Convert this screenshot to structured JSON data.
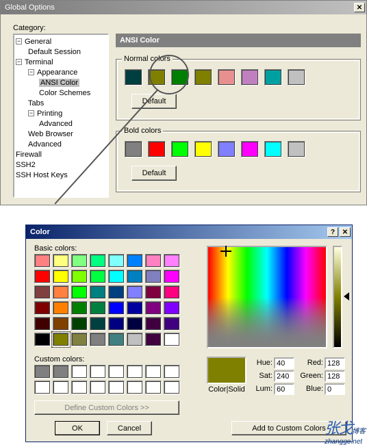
{
  "global": {
    "title": "Global Options",
    "category_label": "Category:",
    "tree": {
      "general": "General",
      "default_session": "Default Session",
      "terminal": "Terminal",
      "appearance": "Appearance",
      "ansi_color": "ANSI Color",
      "color_schemes": "Color Schemes",
      "tabs": "Tabs",
      "printing": "Printing",
      "advanced": "Advanced",
      "web_browser": "Web Browser",
      "advanced2": "Advanced",
      "firewall": "Firewall",
      "ssh2": "SSH2",
      "ssh_host_keys": "SSH Host Keys"
    },
    "panel_title": "ANSI Color",
    "normal_label": "Normal colors",
    "bold_label": "Bold colors",
    "default_btn": "Default",
    "normal_colors": [
      "#003f3f",
      "#808000",
      "#008000",
      "#7f7f00",
      "#e89090",
      "#c080c0",
      "#00a0a0",
      "#c0c0c0"
    ],
    "bold_colors": [
      "#808080",
      "#ff0000",
      "#00ff00",
      "#ffff00",
      "#8080ff",
      "#ff00ff",
      "#00ffff",
      "#c0c0c0"
    ]
  },
  "colordlg": {
    "title": "Color",
    "basic_label": "Basic colors:",
    "custom_label": "Custom colors:",
    "define_btn": "Define Custom Colors >>",
    "ok": "OK",
    "cancel": "Cancel",
    "add": "Add to Custom Colors",
    "preview_label": "Color|Solid",
    "hue_label": "Hue:",
    "sat_label": "Sat:",
    "lum_label": "Lum:",
    "red_label": "Red:",
    "green_label": "Green:",
    "blue_label": "Blue:",
    "hue": "40",
    "sat": "240",
    "lum": "60",
    "red": "128",
    "green": "128",
    "blue": "0",
    "basic_colors": [
      "#ff8080",
      "#ffff80",
      "#80ff80",
      "#00ff80",
      "#80ffff",
      "#0080ff",
      "#ff80c0",
      "#ff80ff",
      "#ff0000",
      "#ffff00",
      "#80ff00",
      "#00ff40",
      "#00ffff",
      "#0080c0",
      "#8080c0",
      "#ff00ff",
      "#804040",
      "#ff8040",
      "#00ff00",
      "#008080",
      "#004080",
      "#8080ff",
      "#800040",
      "#ff0080",
      "#800000",
      "#ff8000",
      "#008000",
      "#008040",
      "#0000ff",
      "#0000a0",
      "#800080",
      "#8000ff",
      "#400000",
      "#804000",
      "#004000",
      "#004040",
      "#000080",
      "#000040",
      "#400040",
      "#400080",
      "#000000",
      "#808000",
      "#808040",
      "#808080",
      "#408080",
      "#c0c0c0",
      "#400040",
      "#ffffff"
    ],
    "custom_colors": [
      "#808080",
      "#808080",
      "#ffffff",
      "#ffffff",
      "#ffffff",
      "#ffffff",
      "#ffffff",
      "#ffffff",
      "#ffffff",
      "#ffffff",
      "#ffffff",
      "#ffffff",
      "#ffffff",
      "#ffffff",
      "#ffffff",
      "#ffffff"
    ]
  },
  "watermark": {
    "cn": "张戈",
    "en": "zhangge.net",
    "sub": "博客"
  }
}
